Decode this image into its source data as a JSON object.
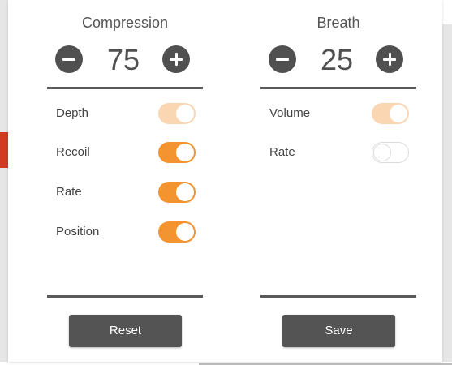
{
  "compression": {
    "title": "Compression",
    "value": "75",
    "items": [
      {
        "label": "Depth",
        "state": "on-dim"
      },
      {
        "label": "Recoil",
        "state": "on"
      },
      {
        "label": "Rate",
        "state": "on"
      },
      {
        "label": "Position",
        "state": "on"
      }
    ],
    "button_label": "Reset"
  },
  "breath": {
    "title": "Breath",
    "value": "25",
    "items": [
      {
        "label": "Volume",
        "state": "on-dim"
      },
      {
        "label": "Rate",
        "state": "off"
      }
    ],
    "button_label": "Save"
  },
  "colors": {
    "accent": "#f39430",
    "accent_dim": "#fad7b2",
    "dark": "#505050"
  },
  "icons": {
    "decrement": "minus-circle-icon",
    "increment": "plus-circle-icon"
  }
}
